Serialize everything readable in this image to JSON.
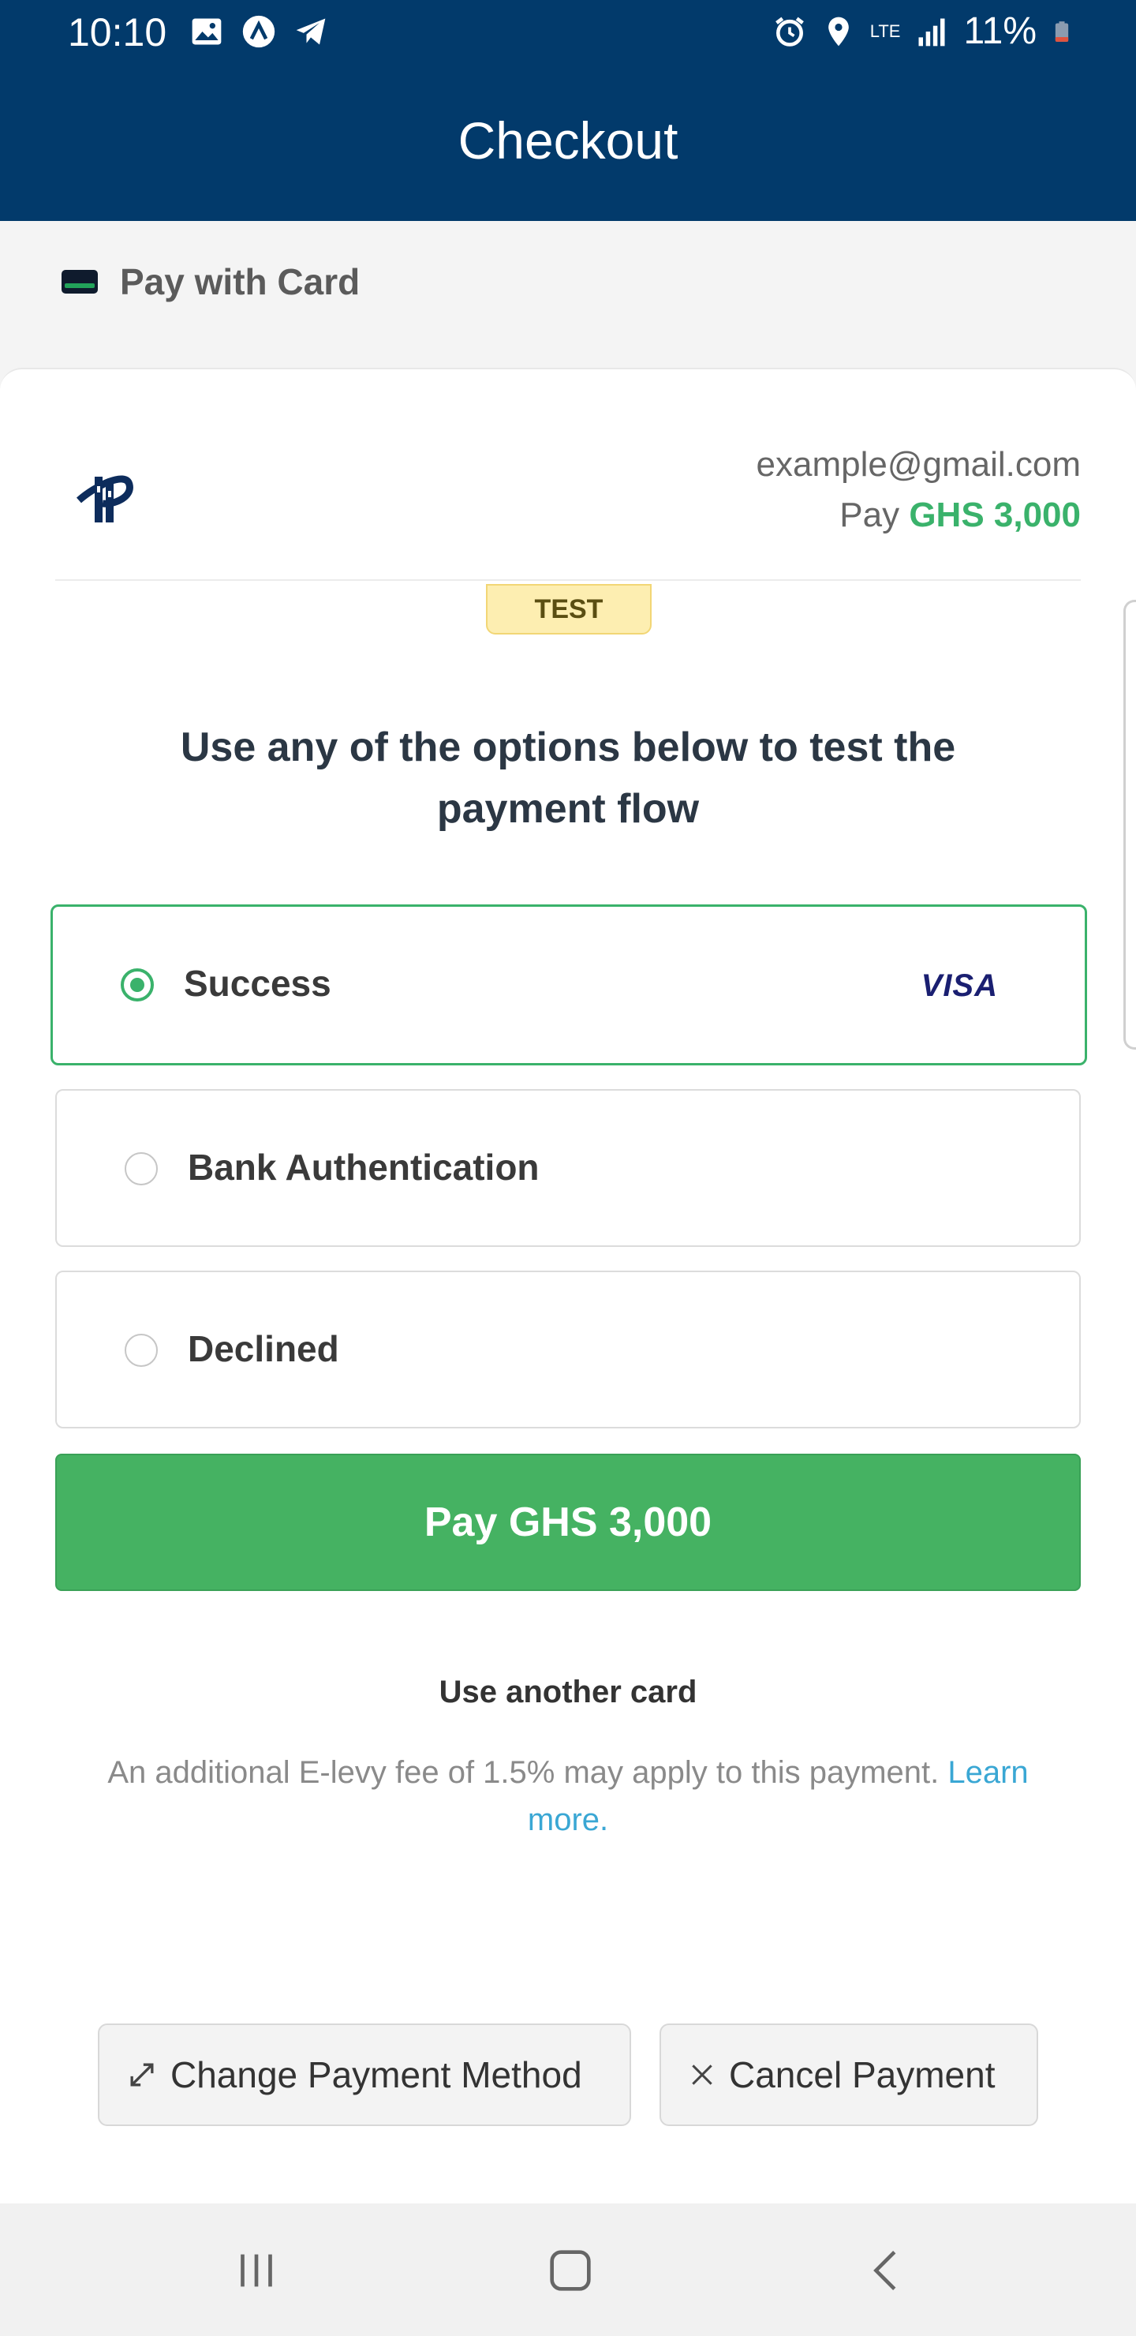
{
  "status": {
    "time": "10:10",
    "battery": "11%",
    "network": "LTE"
  },
  "header": {
    "title": "Checkout"
  },
  "pay_with": {
    "label": "Pay with Card"
  },
  "merchant": {
    "email": "example@gmail.com",
    "pay_prefix": "Pay",
    "amount": "GHS 3,000"
  },
  "badge": "TEST",
  "heading": "Use any of the options below to test the payment flow",
  "options": [
    {
      "label": "Success",
      "brand": "VISA",
      "selected": true
    },
    {
      "label": "Bank Authentication",
      "selected": false
    },
    {
      "label": "Declined",
      "selected": false
    }
  ],
  "pay_button": "Pay GHS 3,000",
  "another_card": "Use another card",
  "fee": {
    "text": "An additional E-levy fee of 1.5% may apply to this payment.",
    "link": "Learn more."
  },
  "actions": {
    "change": "Change Payment Method",
    "cancel": "Cancel Payment"
  },
  "colors": {
    "header": "#023a6b",
    "accent": "#3ab26b",
    "button": "#45b262",
    "link": "#3aa7d4"
  }
}
